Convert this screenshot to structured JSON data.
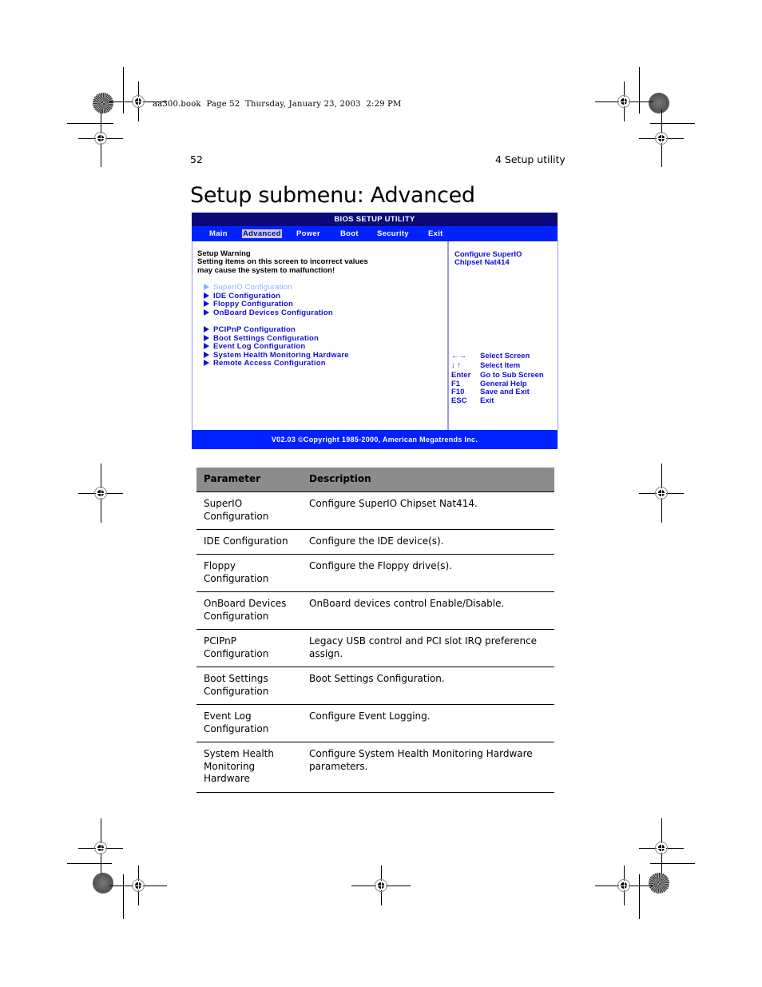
{
  "slug": "aa300.book  Page 52  Thursday, January 23, 2003  2:29 PM",
  "page_number": "52",
  "chapter": "4 Setup utility",
  "heading": "Setup submenu: Advanced",
  "bios": {
    "title": "BIOS SETUP UTILITY",
    "menu": [
      {
        "label": "Main",
        "selected": false
      },
      {
        "label": "Advanced",
        "selected": true
      },
      {
        "label": "Power",
        "selected": false
      },
      {
        "label": "Boot",
        "selected": false
      },
      {
        "label": "Security",
        "selected": false
      },
      {
        "label": "Exit",
        "selected": false
      }
    ],
    "warning_title": "Setup Warning",
    "warning_line1": "Setting items on this screen to incorrect values",
    "warning_line2": "may cause the system to malfunction!",
    "items_group1": [
      {
        "label": "SuperIO Configuration",
        "highlighted": true
      },
      {
        "label": "IDE Configuration"
      },
      {
        "label": "Floppy Configuration"
      },
      {
        "label": "OnBoard Devices Configuration"
      }
    ],
    "items_group2": [
      {
        "label": "PCIPnP Configuration"
      },
      {
        "label": "Boot Settings Configuration"
      },
      {
        "label": "Event Log Configuration"
      },
      {
        "label": "System Health Monitoring Hardware"
      },
      {
        "label": "Remote Access Configuration"
      }
    ],
    "help_line1": "Configure SuperIO",
    "help_line2": "Chipset Nat414",
    "keys": [
      {
        "key": "←→",
        "desc": "Select Screen"
      },
      {
        "key": "↓ ↑",
        "desc": "Select Item"
      },
      {
        "key": "Enter",
        "desc": "Go to Sub Screen"
      },
      {
        "key": "F1",
        "desc": "General Help"
      },
      {
        "key": "F10",
        "desc": "Save and Exit"
      },
      {
        "key": "ESC",
        "desc": "Exit"
      }
    ],
    "footer": "V02.03 ©Copyright 1985-2000, American Megatrends Inc.",
    "colors": {
      "title_bar": "#0a0a7a",
      "menu_bar": "#0022ff",
      "item_text": "#1010d8",
      "highlight_item": "#8ab0ff"
    }
  },
  "table": {
    "headers": {
      "parameter": "Parameter",
      "description": "Description"
    },
    "rows": [
      {
        "parameter": "SuperIO Configuration",
        "description": "Configure SuperIO Chipset Nat414."
      },
      {
        "parameter": "IDE Configuration",
        "description": "Configure the IDE device(s)."
      },
      {
        "parameter": "Floppy Configuration",
        "description": "Configure the Floppy drive(s)."
      },
      {
        "parameter": "OnBoard Devices Configuration",
        "description": "OnBoard devices control Enable/Disable."
      },
      {
        "parameter": "PCIPnP Configuration",
        "description": "Legacy USB control and PCI slot IRQ preference assign."
      },
      {
        "parameter": "Boot Settings Configuration",
        "description": "Boot Settings Configuration."
      },
      {
        "parameter": "Event Log Configuration",
        "description": "Configure Event Logging."
      },
      {
        "parameter": "System Health Monitoring Hardware",
        "description": "Configure System Health Monitoring Hardware parameters."
      }
    ]
  }
}
